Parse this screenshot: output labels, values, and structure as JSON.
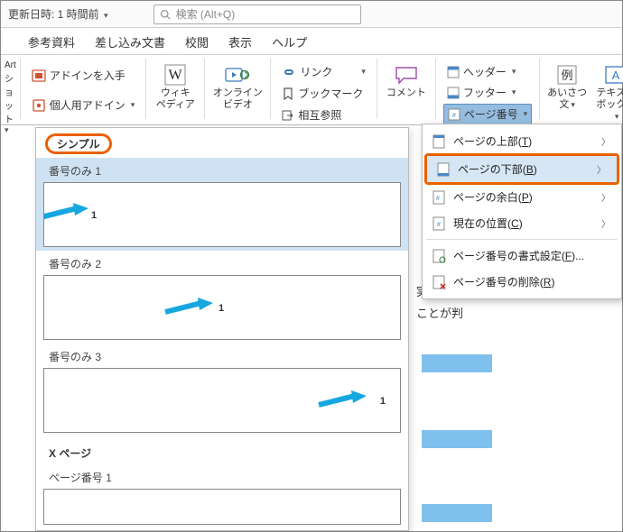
{
  "infobar": {
    "last_modified_label": "更新日時: 1 時間前",
    "search_placeholder": "検索 (Alt+Q)"
  },
  "tabs": {
    "references": "参考資料",
    "mailings": "差し込み文書",
    "review": "校閲",
    "view": "表示",
    "help": "ヘルプ"
  },
  "ribbon": {
    "left_cropped_1": "Art",
    "left_cropped_2": "ショット",
    "addins_get": "アドインを入手",
    "addins_my": "個人用アドイン",
    "wikipedia_line1": "ウィキ",
    "wikipedia_line2": "ペディア",
    "online_video_line1": "オンライン",
    "online_video_line2": "ビデオ",
    "link": "リンク",
    "bookmark": "ブックマーク",
    "crossref": "相互参照",
    "comment": "コメント",
    "header": "ヘッダー",
    "footer": "フッター",
    "page_number": "ページ番号",
    "greeting_line1": "あいさつ",
    "greeting_line2": "文",
    "textbox_line1": "テキスト",
    "textbox_line2": "ボックス"
  },
  "popup": {
    "top_of_page": "ページの上部",
    "top_key": "T",
    "bottom_of_page": "ページの下部",
    "bottom_key": "B",
    "margin": "ページの余白",
    "margin_key": "P",
    "current_pos": "現在の位置",
    "current_key": "C",
    "format": "ページ番号の書式設定",
    "format_key": "F",
    "remove": "ページ番号の削除",
    "remove_key": "R"
  },
  "gallery": {
    "header": "シンプル",
    "items": [
      {
        "title": "番号のみ 1",
        "num": "1"
      },
      {
        "title": "番号のみ 2",
        "num": "1"
      },
      {
        "title": "番号のみ 3",
        "num": "1"
      }
    ],
    "group2": "X ページ",
    "group2_item": "ページ番号 1"
  },
  "behind": {
    "text1": "実施。",
    "text2": "ことが判"
  }
}
